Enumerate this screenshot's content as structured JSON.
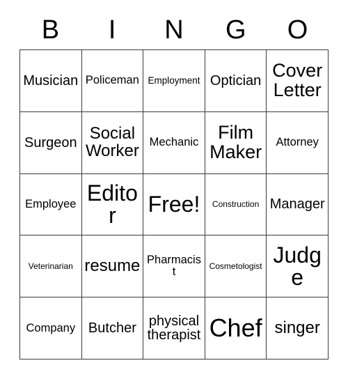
{
  "card": {
    "type": "bingo-card",
    "columns": 5,
    "rows": 5,
    "background_color": "#ffffff",
    "text_color": "#000000",
    "border_color": "#3a3a3a",
    "headers": [
      {
        "label": "B"
      },
      {
        "label": "I"
      },
      {
        "label": "N"
      },
      {
        "label": "G"
      },
      {
        "label": "O"
      }
    ],
    "cells": [
      {
        "text": "Musician",
        "size": "fs-lg",
        "free": false
      },
      {
        "text": "Policeman",
        "size": "fs-md",
        "free": false
      },
      {
        "text": "Employment",
        "size": "fs-sm",
        "free": false
      },
      {
        "text": "Optician",
        "size": "fs-lg",
        "free": false
      },
      {
        "text": "Cover\nLetter",
        "size": "fs-2xl",
        "free": false
      },
      {
        "text": "Surgeon",
        "size": "fs-lg",
        "free": false
      },
      {
        "text": "Social\nWorker",
        "size": "fs-xl",
        "free": false
      },
      {
        "text": "Mechanic",
        "size": "fs-md",
        "free": false
      },
      {
        "text": "Film\nMaker",
        "size": "fs-2xl",
        "free": false
      },
      {
        "text": "Attorney",
        "size": "fs-md",
        "free": false
      },
      {
        "text": "Employee",
        "size": "fs-md",
        "free": false
      },
      {
        "text": "Editor",
        "size": "fs-3xl",
        "free": false
      },
      {
        "text": "Free!",
        "size": "fs-3xl",
        "free": true
      },
      {
        "text": "Construction",
        "size": "fs-xs",
        "free": false
      },
      {
        "text": "Manager",
        "size": "fs-lg",
        "free": false
      },
      {
        "text": "Veterinarian",
        "size": "fs-xs",
        "free": false
      },
      {
        "text": "resume",
        "size": "fs-xl",
        "free": false
      },
      {
        "text": "Pharmacist",
        "size": "fs-md",
        "free": false
      },
      {
        "text": "Cosmetologist",
        "size": "fs-xs",
        "free": false
      },
      {
        "text": "Judge",
        "size": "fs-3xl",
        "free": false
      },
      {
        "text": "Company",
        "size": "fs-md",
        "free": false
      },
      {
        "text": "Butcher",
        "size": "fs-lg",
        "free": false
      },
      {
        "text": "physical\ntherapist",
        "size": "fs-lg",
        "free": false
      },
      {
        "text": "Chef",
        "size": "fs-4xl",
        "free": false
      },
      {
        "text": "singer",
        "size": "fs-xl",
        "free": false
      }
    ]
  }
}
